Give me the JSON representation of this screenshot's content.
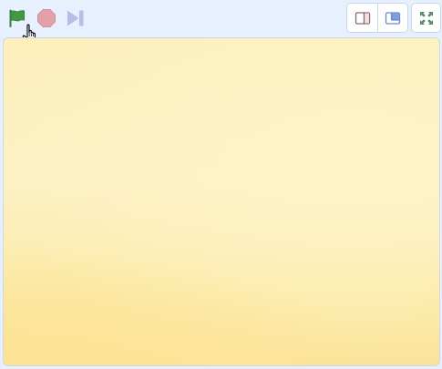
{
  "controls": {
    "green_flag": {
      "icon": "green-flag-icon",
      "color": "#3d8f4e"
    },
    "stop": {
      "icon": "stop-icon",
      "color": "#e2a1a9"
    },
    "step": {
      "icon": "step-icon",
      "color": "#b7bde8"
    }
  },
  "layout": {
    "small_stage": {
      "icon": "small-stage-icon"
    },
    "large_stage": {
      "icon": "large-stage-icon"
    },
    "fullscreen": {
      "icon": "fullscreen-icon"
    }
  },
  "stage": {
    "background_top": "#fdf0bd",
    "background_bottom": "#fbe49a"
  },
  "colors": {
    "toolbar_bg": "#e6f0ff",
    "accent_blue": "#4c97ff",
    "border": "#c9d6ea"
  }
}
